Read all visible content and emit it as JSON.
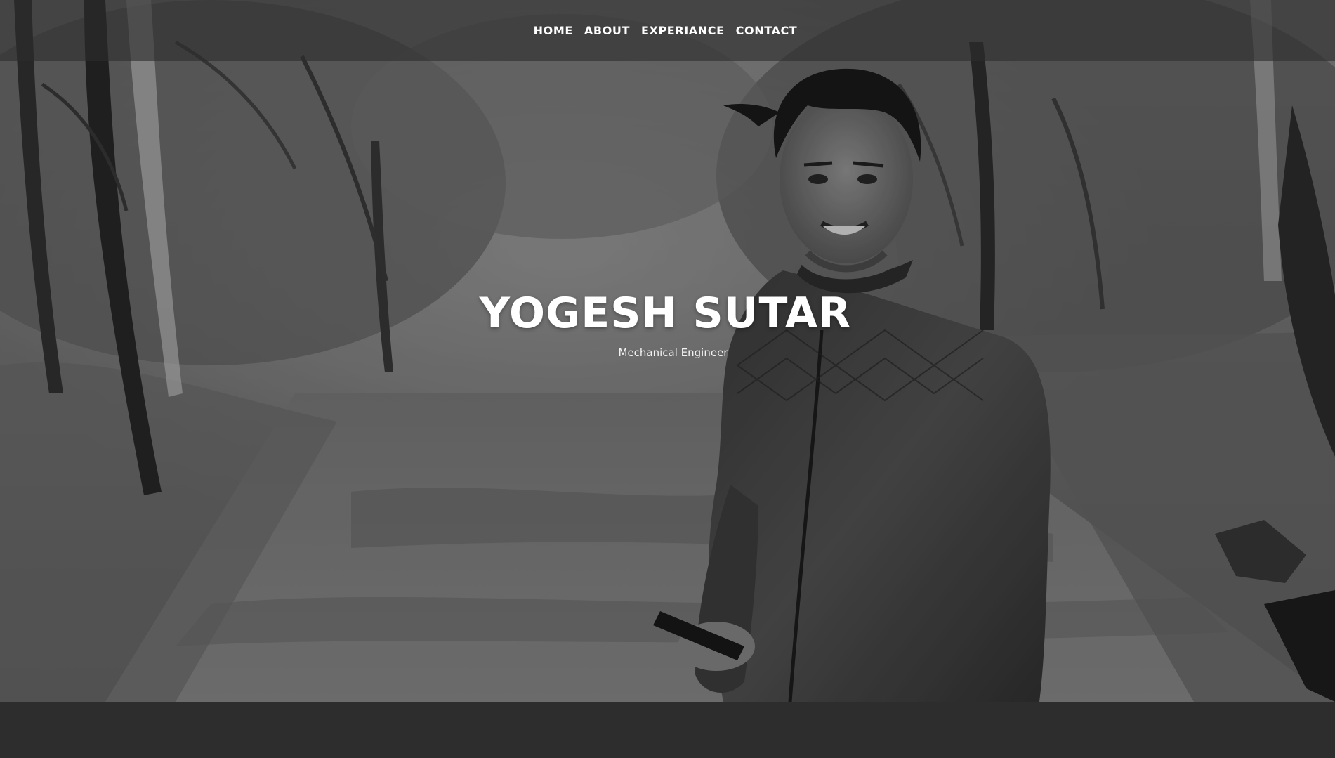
{
  "nav": {
    "items": [
      {
        "label": "HOME"
      },
      {
        "label": "ABOUT"
      },
      {
        "label": "EXPERIANCE"
      },
      {
        "label": "CONTACT"
      }
    ]
  },
  "banner": {
    "title": "YOGESH SUTAR",
    "subtitle": "Mechanical Engineer"
  },
  "hero": {
    "image": "grayscale-portrait-forest-path",
    "tone": "monochrome"
  },
  "colors": {
    "navbar_bg": "#2d2d2d",
    "footer_bg": "#2d2d2d",
    "text": "#ffffff"
  }
}
